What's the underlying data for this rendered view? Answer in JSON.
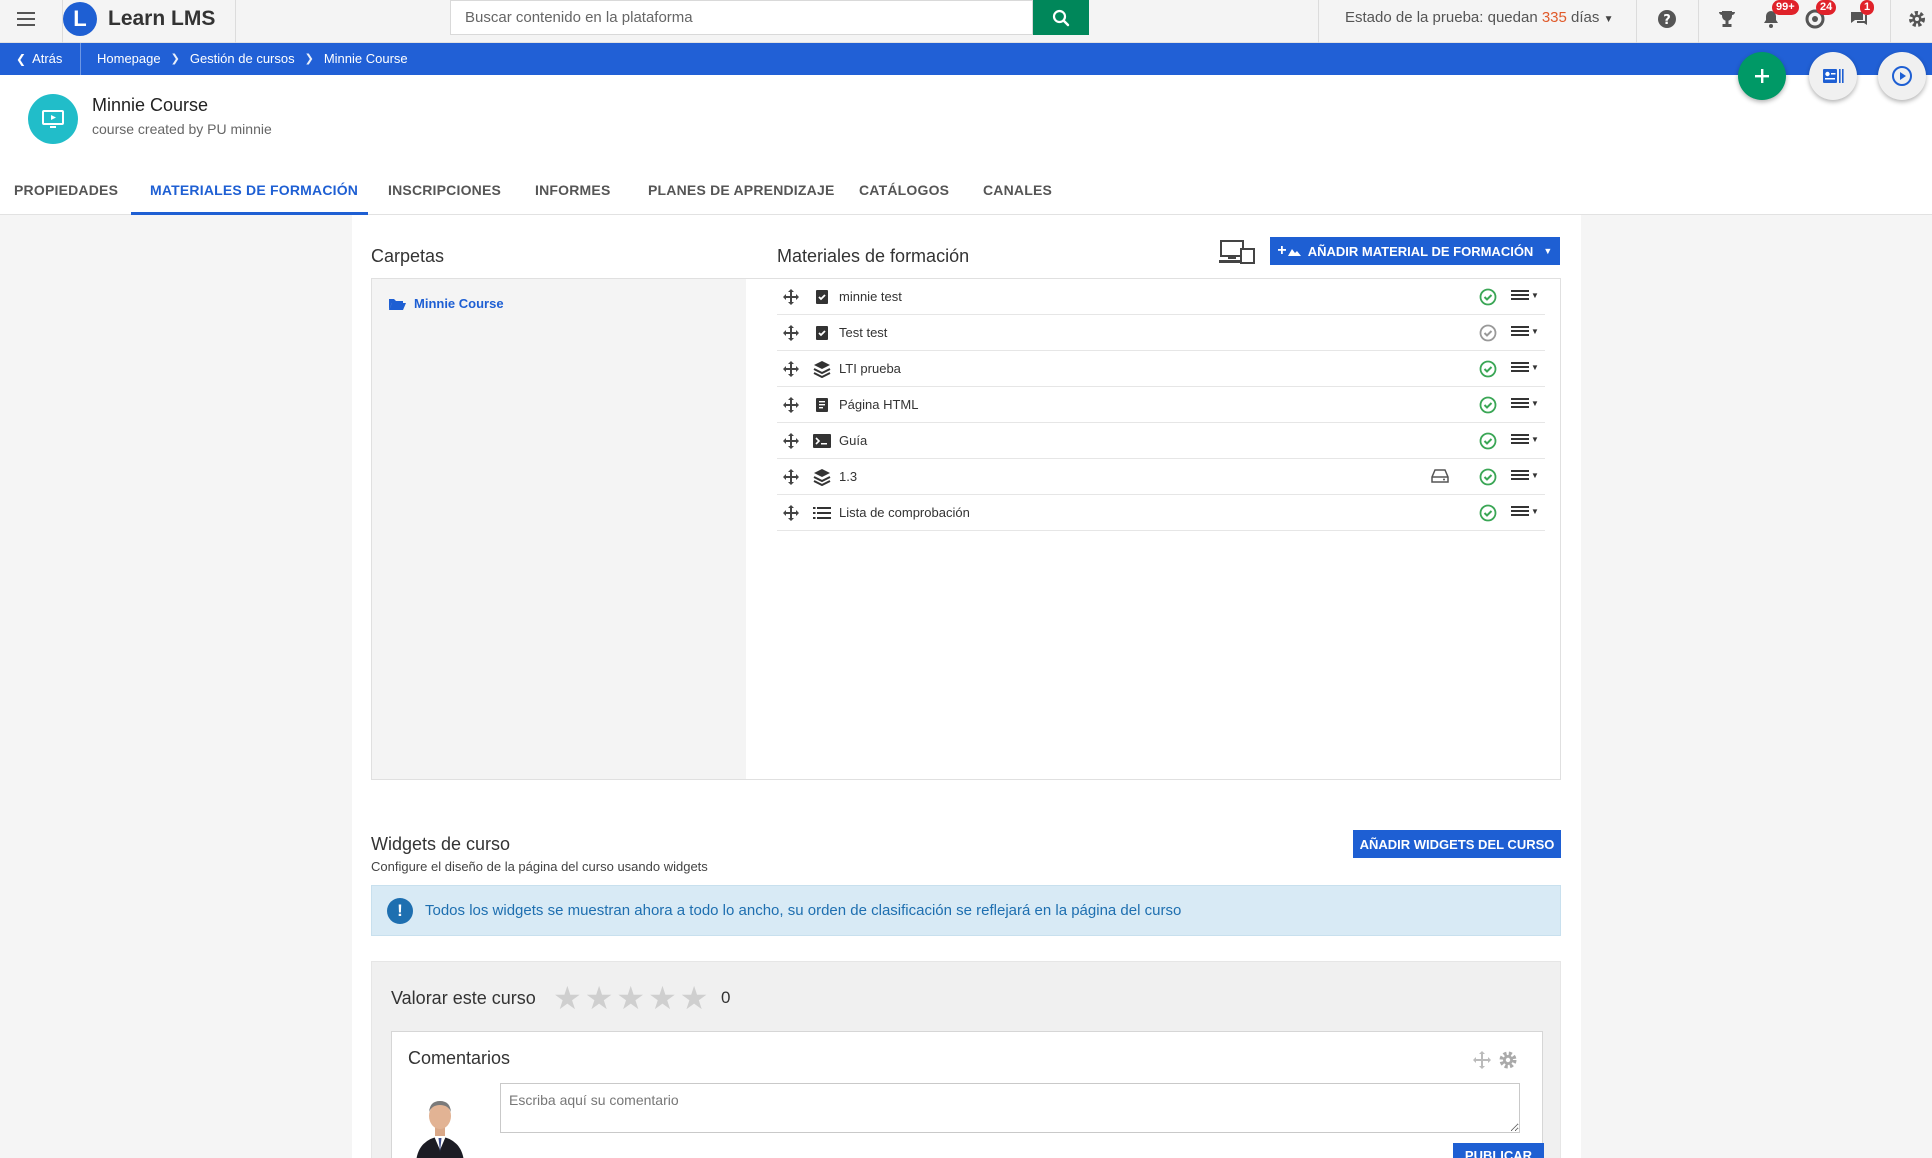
{
  "app": {
    "logo_letter": "L",
    "name": "Learn LMS"
  },
  "search": {
    "placeholder": "Buscar contenido en la plataforma"
  },
  "trial": {
    "prefix": "Estado de la prueba: quedan",
    "days": "335",
    "suffix": "días"
  },
  "notifications": {
    "bell_count": "99+",
    "support_count": "24",
    "chat_count": "1"
  },
  "breadcrumb": {
    "back_label": "Atrás",
    "items": [
      "Homepage",
      "Gestión de cursos",
      "Minnie Course"
    ]
  },
  "course": {
    "title": "Minnie Course",
    "subtitle": "course created by PU minnie"
  },
  "tabs": [
    "PROPIEDADES",
    "MATERIALES DE FORMACIÓN",
    "INSCRIPCIONES",
    "INFORMES",
    "PLANES DE APRENDIZAJE",
    "CATÁLOGOS",
    "CANALES"
  ],
  "folders": {
    "title": "Carpetas",
    "items": [
      "Minnie Course"
    ]
  },
  "materials": {
    "title": "Materiales de formación",
    "add_button": "AÑADIR MATERIAL DE FORMACIÓN",
    "items": [
      {
        "name": "minnie test",
        "type_icon": "test-icon",
        "status": "active"
      },
      {
        "name": "Test test",
        "type_icon": "test-icon",
        "status": "inactive"
      },
      {
        "name": "LTI prueba",
        "type_icon": "layers-icon",
        "status": "active"
      },
      {
        "name": "Página HTML",
        "type_icon": "html-page-icon",
        "status": "active"
      },
      {
        "name": "Guía",
        "type_icon": "guide-icon",
        "status": "active"
      },
      {
        "name": "1.3",
        "type_icon": "layers-icon",
        "status": "active"
      },
      {
        "name": "Lista de comprobación",
        "type_icon": "checklist-icon",
        "status": "active"
      }
    ]
  },
  "widgets": {
    "title": "Widgets de curso",
    "subtitle": "Configure el diseño de la página del curso usando widgets",
    "add_button": "AÑADIR WIDGETS DEL CURSO",
    "info": "Todos los widgets se muestran ahora a todo lo ancho, su orden de clasificación se reflejará en la página del curso"
  },
  "rating": {
    "label": "Valorar este curso",
    "count": "0",
    "stars": 5,
    "value": 0
  },
  "comments": {
    "title": "Comentarios",
    "placeholder": "Escriba aquí su comentario",
    "publish_button": "PUBLICAR"
  },
  "colors": {
    "primary": "#1e5fd3",
    "green": "#00875a",
    "status_green": "#3aa655",
    "info_bg": "#d8eaf5"
  }
}
